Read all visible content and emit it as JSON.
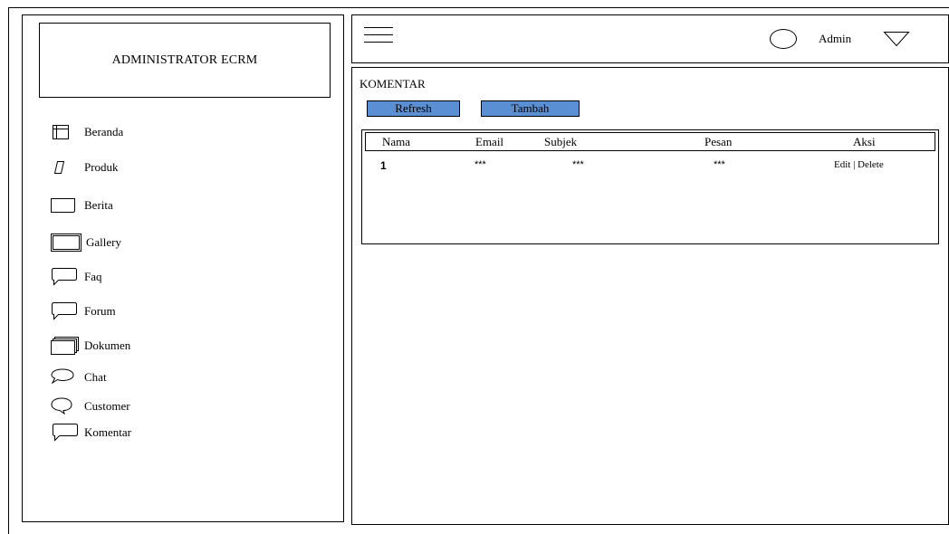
{
  "sidebar": {
    "brand": "ADMINISTRATOR ECRM",
    "items": [
      {
        "label": "Beranda",
        "icon": "table-icon"
      },
      {
        "label": "Produk",
        "icon": "parallelogram-icon"
      },
      {
        "label": "Berita",
        "icon": "note-icon"
      },
      {
        "label": "Gallery",
        "icon": "frame-icon"
      },
      {
        "label": "Faq",
        "icon": "speech-bubble-icon"
      },
      {
        "label": "Forum",
        "icon": "speech-bubble-icon"
      },
      {
        "label": "Dokumen",
        "icon": "documents-icon"
      },
      {
        "label": "Chat",
        "icon": "chat-bubble-icon"
      },
      {
        "label": "Customer",
        "icon": "oval-callout-icon"
      },
      {
        "label": "Komentar",
        "icon": "speech-bubble-icon"
      }
    ]
  },
  "header": {
    "user": "Admin",
    "icons": [
      "menu-icon",
      "user-circle-icon",
      "dropdown-triangle-icon"
    ]
  },
  "main": {
    "title": "KOMENTAR",
    "buttons": {
      "refresh": "Refresh",
      "tambah": "Tambah"
    },
    "table": {
      "columns": [
        "Nama",
        "Email",
        "Subjek",
        "Pesan",
        "Aksi"
      ],
      "rows": [
        {
          "nama": "1",
          "email": "***",
          "subjek": "***",
          "pesan": "***",
          "aksi": {
            "edit": "Edit",
            "separator": "|",
            "delete": "Delete"
          }
        }
      ]
    }
  },
  "colors": {
    "button_fill": "#5b8fd4",
    "line": "#000000",
    "background": "#ffffff"
  }
}
